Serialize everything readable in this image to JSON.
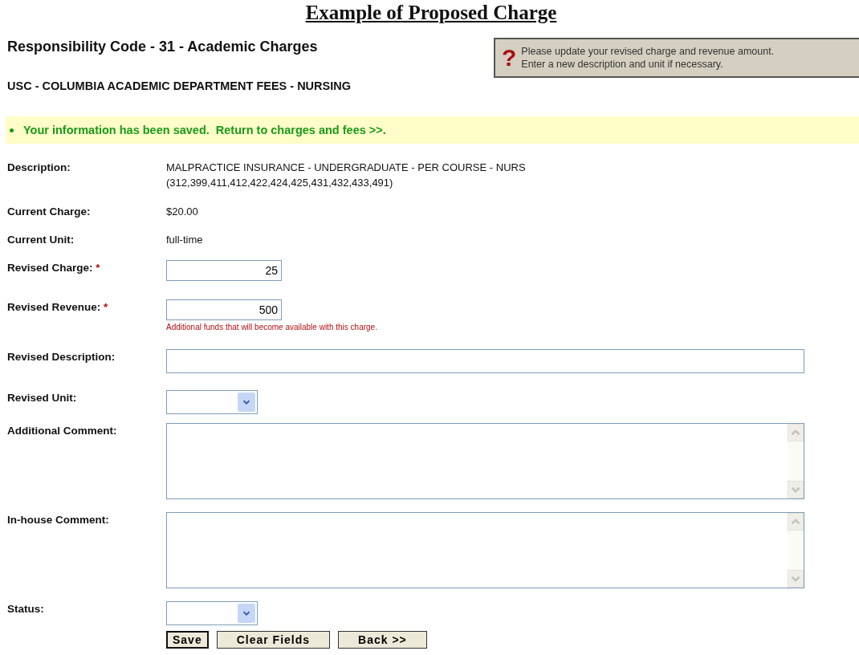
{
  "page_title": "Example of Proposed Charge",
  "heading": "Responsibility Code - 31 - Academic Charges",
  "help_box": {
    "icon": "?",
    "lines": [
      "Please update your revised charge and revenue amount.",
      "Enter a new description and unit if necessary."
    ]
  },
  "department": "USC - COLUMBIA ACADEMIC DEPARTMENT FEES - NURSING",
  "notice": {
    "text": "Your information has been saved.  Return to charges and fees >>."
  },
  "fields": [
    {
      "kind": "text",
      "label": "Description:",
      "lines": [
        "MALPRACTICE INSURANCE - UNDERGRADUATE - PER COURSE - NURS",
        "(312,399,411,412,422,424,425,431,432,433,491)"
      ]
    },
    {
      "kind": "text",
      "label": "Current Charge:",
      "lines": [
        "$20.00"
      ]
    },
    {
      "kind": "text",
      "label": "Current Unit:",
      "lines": [
        "full-time"
      ]
    },
    {
      "kind": "input",
      "label": "Revised Charge:",
      "required_mark": "*",
      "value": "25"
    },
    {
      "kind": "input",
      "label": "Revised Revenue:",
      "required_mark": "*",
      "value": "500",
      "hint": "Additional funds that will become available with this charge."
    },
    {
      "kind": "wide",
      "label": "Revised Description:"
    },
    {
      "kind": "select",
      "label": "Revised Unit:"
    },
    {
      "kind": "textarea",
      "label": "Additional Comment:"
    },
    {
      "kind": "textarea",
      "label": "In-house Comment:"
    },
    {
      "kind": "select",
      "label": "Status:"
    }
  ],
  "buttons": [
    {
      "label": "Save",
      "focused": true
    },
    {
      "label": "Clear Fields",
      "focused": false
    },
    {
      "label": "Back >>",
      "focused": false
    }
  ]
}
